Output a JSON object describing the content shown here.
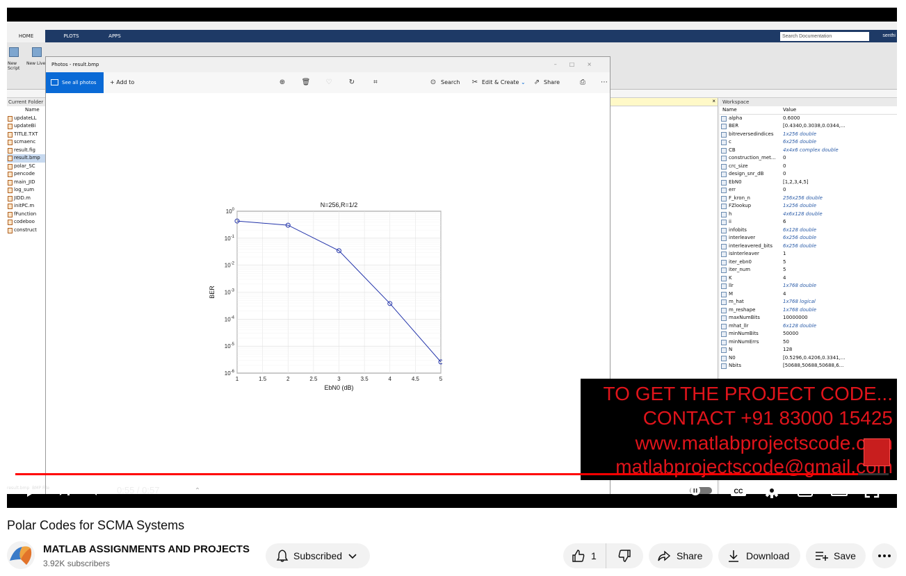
{
  "matlab": {
    "tabs": [
      "HOME",
      "PLOTS",
      "APPS"
    ],
    "search_placeholder": "Search Documentation",
    "user_label": "senthi",
    "toolstrip": [
      "New Script",
      "New Live Script"
    ],
    "current_folder": {
      "title": "Current Folder",
      "header": "Name",
      "files": [
        "updateLL",
        "updateBi",
        "TITLE.TXT",
        "scmaenc",
        "result.fig",
        "result.bmp",
        "polar_SC",
        "pencode",
        "main_JID",
        "log_sum",
        "JIDD.m",
        "initPC.m",
        "fFunction",
        "codeboo",
        "construct"
      ],
      "selected_index": 5
    },
    "workspace": {
      "title": "Workspace",
      "columns": [
        "Name",
        "Value"
      ],
      "variables": [
        {
          "name": "alpha",
          "value": "0.6000",
          "italic": false
        },
        {
          "name": "BER",
          "value": "[0.4340,0.3038,0.0344,...",
          "italic": false
        },
        {
          "name": "bitreversedindices",
          "value": "1x256 double",
          "italic": true
        },
        {
          "name": "c",
          "value": "6x256 double",
          "italic": true
        },
        {
          "name": "CB",
          "value": "4x4x6 complex double",
          "italic": true
        },
        {
          "name": "construction_met...",
          "value": "0",
          "italic": false
        },
        {
          "name": "crc_size",
          "value": "0",
          "italic": false
        },
        {
          "name": "design_snr_dB",
          "value": "0",
          "italic": false
        },
        {
          "name": "EbN0",
          "value": "[1,2,3,4,5]",
          "italic": false
        },
        {
          "name": "err",
          "value": "0",
          "italic": false
        },
        {
          "name": "F_kron_n",
          "value": "256x256 double",
          "italic": true
        },
        {
          "name": "FZlookup",
          "value": "1x256 double",
          "italic": true
        },
        {
          "name": "h",
          "value": "4x6x128 double",
          "italic": true
        },
        {
          "name": "ii",
          "value": "6",
          "italic": false
        },
        {
          "name": "infobits",
          "value": "6x128 double",
          "italic": true
        },
        {
          "name": "interleaver",
          "value": "6x256 double",
          "italic": true
        },
        {
          "name": "interleavered_bits",
          "value": "6x256 double",
          "italic": true
        },
        {
          "name": "isInterleaver",
          "value": "1",
          "italic": false
        },
        {
          "name": "iter_ebn0",
          "value": "5",
          "italic": false
        },
        {
          "name": "iter_num",
          "value": "5",
          "italic": false
        },
        {
          "name": "K",
          "value": "4",
          "italic": false
        },
        {
          "name": "llr",
          "value": "1x768 double",
          "italic": true
        },
        {
          "name": "M",
          "value": "4",
          "italic": false
        },
        {
          "name": "m_hat",
          "value": "1x768 logical",
          "italic": true
        },
        {
          "name": "m_reshape",
          "value": "1x768 double",
          "italic": true
        },
        {
          "name": "maxNumBits",
          "value": "10000000",
          "italic": false
        },
        {
          "name": "mhat_llr",
          "value": "6x128 double",
          "italic": true
        },
        {
          "name": "minNumBits",
          "value": "50000",
          "italic": false
        },
        {
          "name": "minNumErrs",
          "value": "50",
          "italic": false
        },
        {
          "name": "N",
          "value": "128",
          "italic": false
        },
        {
          "name": "N0",
          "value": "[0.5296,0.4206,0.3341,...",
          "italic": false
        },
        {
          "name": "Nbits",
          "value": "[50688,50688,50688,6...",
          "italic": false
        }
      ]
    }
  },
  "photos": {
    "window_title": "Photos - result.bmp",
    "see_all": "See all photos",
    "add_to": "+ Add to",
    "search": "Search",
    "edit_create": "Edit & Create",
    "share": "Share"
  },
  "chart_data": {
    "type": "line",
    "title": "N=256,R=1/2",
    "xlabel": "EbN0 (dB)",
    "ylabel": "BER",
    "yscale": "log",
    "xlim": [
      1,
      5
    ],
    "ylim": [
      1e-06,
      1
    ],
    "grid": true,
    "x_ticks": [
      "1",
      "1.5",
      "2",
      "2.5",
      "3",
      "3.5",
      "4",
      "4.5",
      "5"
    ],
    "y_tick_exponents": [
      "0",
      "-1",
      "-2",
      "-3",
      "-4",
      "-5",
      "-6"
    ],
    "series": [
      {
        "x": [
          1,
          2,
          3,
          4,
          5
        ],
        "y": [
          0.434,
          0.3038,
          0.0344,
          0.00038,
          2.6e-06
        ],
        "color": "#2233aa",
        "marker": "circle"
      }
    ]
  },
  "promo": {
    "line1": "TO GET THE PROJECT CODE...",
    "line2": "CONTACT +91 83000 15425",
    "line3": "www.matlabprojectscode.com",
    "line4": "matlabprojectscode@gmail.com",
    "color": "#e0141b"
  },
  "player": {
    "time": "0:55 / 0:57",
    "progress": 0.965,
    "accent": "#ff0000",
    "taskbar_label": "BMP File"
  },
  "video": {
    "title": "Polar Codes for SCMA Systems",
    "channel": "MATLAB ASSIGNMENTS AND PROJECTS",
    "subscribers": "3.92K subscribers",
    "subscribe_label": "Subscribed",
    "likes": "1",
    "share_label": "Share",
    "download_label": "Download",
    "save_label": "Save"
  }
}
